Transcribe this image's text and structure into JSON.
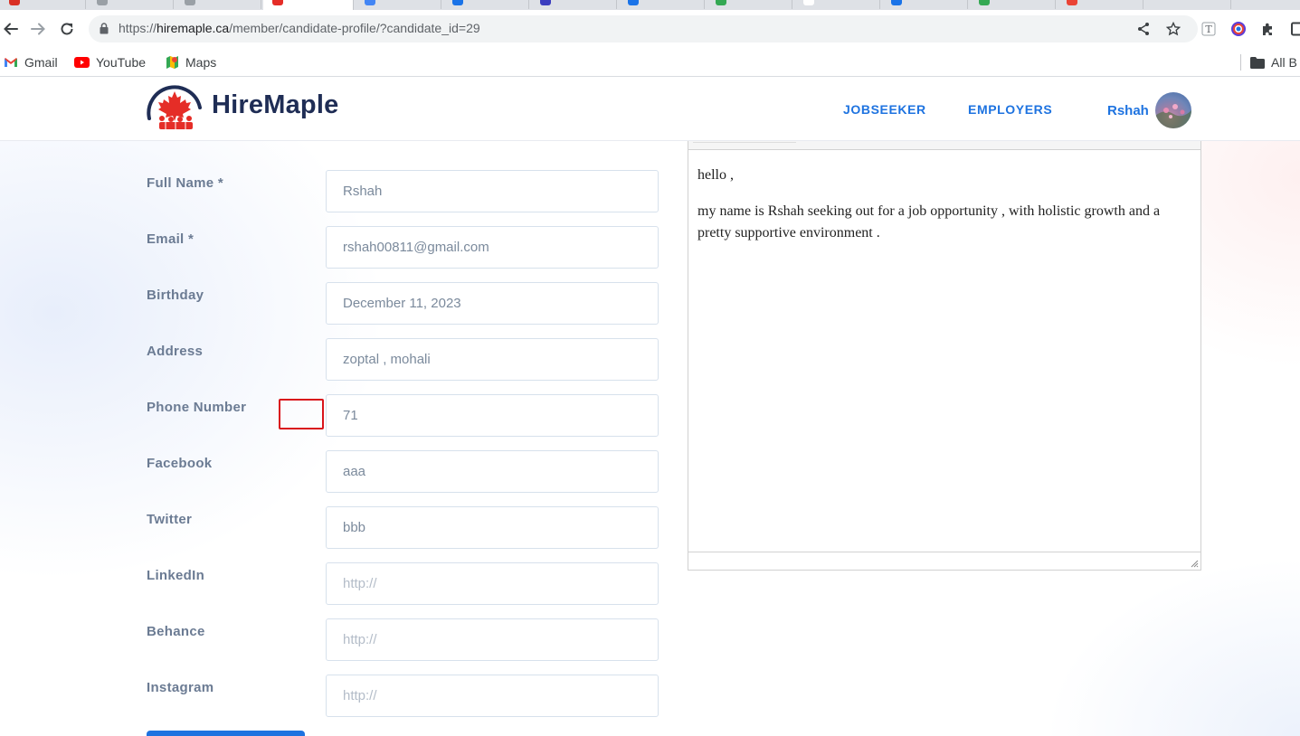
{
  "browser": {
    "url_prefix": "https://",
    "url_host": "hiremaple.ca",
    "url_path": "/member/candidate-profile/?candidate_id=29",
    "bookmarks": [
      {
        "label": "Gmail",
        "icon": "gmail-icon"
      },
      {
        "label": "YouTube",
        "icon": "youtube-icon"
      },
      {
        "label": "Maps",
        "icon": "maps-icon"
      }
    ],
    "all_bookmarks_label": "All B",
    "colors": {
      "tab_strip": "#dee1e6",
      "omnibox": "#f1f3f4"
    }
  },
  "site": {
    "brand": "HireMaple",
    "nav": [
      {
        "label": "JOBSEEKER"
      },
      {
        "label": "EMPLOYERS"
      }
    ],
    "user": {
      "name": "Rshah"
    },
    "colors": {
      "primary": "#1e73e0",
      "brand_dark": "#1f2d55",
      "brand_red": "#e52d27",
      "label": "#6b7b93"
    }
  },
  "form": {
    "fields": [
      {
        "label": "Full Name *",
        "value": "Rshah",
        "placeholder": ""
      },
      {
        "label": "Email *",
        "value": "rshah00811@gmail.com",
        "placeholder": ""
      },
      {
        "label": "Birthday",
        "value": "December 11, 2023",
        "placeholder": ""
      },
      {
        "label": "Address",
        "value": "zoptal , mohali",
        "placeholder": ""
      },
      {
        "label": "Phone Number",
        "value": "71",
        "placeholder": ""
      },
      {
        "label": "Facebook",
        "value": "aaa",
        "placeholder": ""
      },
      {
        "label": "Twitter",
        "value": "bbb",
        "placeholder": ""
      },
      {
        "label": "LinkedIn",
        "value": "",
        "placeholder": "http://"
      },
      {
        "label": "Behance",
        "value": "",
        "placeholder": "http://"
      },
      {
        "label": "Instagram",
        "value": "",
        "placeholder": "http://"
      }
    ]
  },
  "editor": {
    "paragraphs": [
      "hello ,",
      "my name is Rshah seeking out for a job opportunity , with holistic growth  and a pretty supportive environment ."
    ]
  }
}
